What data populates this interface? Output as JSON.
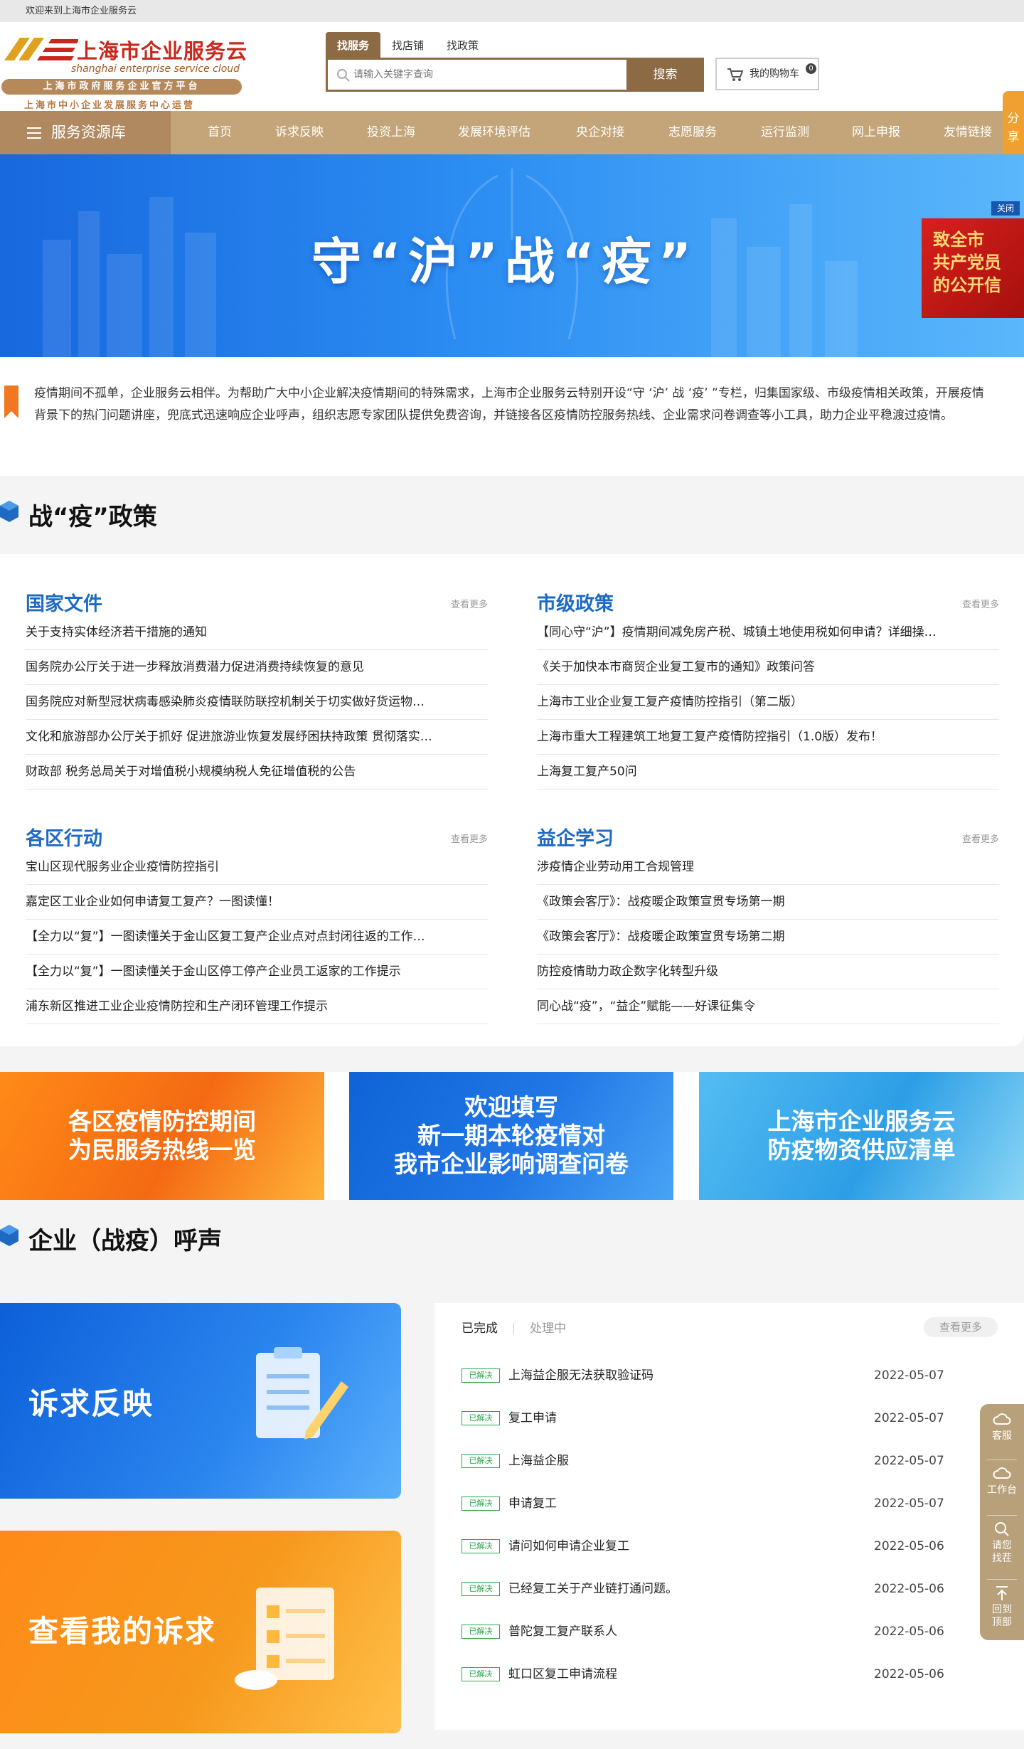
{
  "topbar": {
    "welcome": "欢迎来到上海市企业服务云"
  },
  "logo": {
    "title": "上海市企业服务云",
    "subtitle": "shanghai enterprise service cloud",
    "band": "上海市政府服务企业官方平台",
    "run": "上海市中小企业发展服务中心运营"
  },
  "search": {
    "tabs": [
      "找服务",
      "找店铺",
      "找政策"
    ],
    "placeholder": "请输入关键字查询",
    "button": "搜索"
  },
  "cart": {
    "label": "我的购物车",
    "count": "0"
  },
  "nav": {
    "resource": "服务资源库",
    "items": [
      "首页",
      "诉求反映",
      "投资上海",
      "发展环境评估",
      "央企对接",
      "志愿服务",
      "运行监测",
      "网上申报",
      "友情链接"
    ]
  },
  "share": {
    "label": "分享"
  },
  "banner": {
    "title": "守“沪”战“疫”",
    "close": "关闭",
    "promo_lines": [
      "致全市",
      "共产党员",
      "的公开信"
    ]
  },
  "intro": {
    "text": "疫情期间不孤单，企业服务云相伴。为帮助广大中小企业解决疫情期间的特殊需求，上海市企业服务云特别开设“守 ‘沪’ 战 ‘疫’ ”专栏，归集国家级、市级疫情相关政策，开展疫情背景下的热门问题讲座，兜底式迅速响应企业呼声，组织志愿专家团队提供免费咨询，并链接各区疫情防控服务热线、企业需求问卷调查等小工具，助力企业平稳渡过疫情。"
  },
  "policy": {
    "title": "战“疫”政策",
    "more": "查看更多",
    "columns": [
      {
        "title": "国家文件",
        "items": [
          "关于支持实体经济若干措施的通知",
          "国务院办公厅关于进一步释放消费潜力促进消费持续恢复的意见",
          "国务院应对新型冠状病毒感染肺炎疫情联防联控机制关于切实做好货运物…",
          "文化和旅游部办公厅关于抓好 促进旅游业恢复发展纾困扶持政策 贯彻落实…",
          "财政部 税务总局关于对增值税小规模纳税人免征增值税的公告"
        ]
      },
      {
        "title": "市级政策",
        "items": [
          "【同心守“沪”】疫情期间减免房产税、城镇土地使用税如何申请？详细操…",
          "《关于加快本市商贸企业复工复市的通知》政策问答",
          "上海市工业企业复工复产疫情防控指引（第二版）",
          "上海市重大工程建筑工地复工复产疫情防控指引（1.0版）发布！",
          "上海复工复产50问"
        ]
      },
      {
        "title": "各区行动",
        "items": [
          "宝山区现代服务业企业疫情防控指引",
          "嘉定区工业企业如何申请复工复产？一图读懂！",
          "【全力以“复”】一图读懂关于金山区复工复产企业点对点封闭往返的工作…",
          "【全力以“复”】一图读懂关于金山区停工停产企业员工返家的工作提示",
          "浦东新区推进工业企业疫情防控和生产闭环管理工作提示"
        ]
      },
      {
        "title": "益企学习",
        "items": [
          "涉疫情企业劳动用工合规管理",
          "《政策会客厅》：战疫暖企政策宣贯专场第一期",
          "《政策会客厅》：战疫暖企政策宣贯专场第二期",
          "防控疫情助力政企数字化转型升级",
          "同心战“疫”，“益企”赋能——好课征集令"
        ]
      }
    ]
  },
  "promos": [
    {
      "lines": [
        "各区疫情防控期间",
        "为民服务热线一览"
      ]
    },
    {
      "lines": [
        "欢迎填写",
        "新一期本轮疫情对",
        "我市企业影响调查问卷"
      ]
    },
    {
      "lines": [
        "上海市企业服务云",
        "防疫物资供应清单"
      ]
    }
  ],
  "voice": {
    "title": "企业（战疫）呼声",
    "card1": "诉求反映",
    "card2": "查看我的诉求",
    "tabs": [
      "已完成",
      "处理中"
    ],
    "more": "查看更多",
    "badge": "已解决",
    "requests": [
      {
        "text": "上海益企服无法获取验证码",
        "date": "2022-05-07"
      },
      {
        "text": "复工申请",
        "date": "2022-05-07"
      },
      {
        "text": "上海益企服",
        "date": "2022-05-07"
      },
      {
        "text": "申请复工",
        "date": "2022-05-07"
      },
      {
        "text": "请问如何申请企业复工",
        "date": "2022-05-06"
      },
      {
        "text": "已经复工关于产业链打通问题。",
        "date": "2022-05-06"
      },
      {
        "text": "普陀复工复产联系人",
        "date": "2022-05-06"
      },
      {
        "text": "虹口区复工申请流程",
        "date": "2022-05-06"
      }
    ]
  },
  "floatbar": {
    "service": "客服",
    "workbench": "工作台",
    "find": [
      "请您",
      "找茬"
    ],
    "top": [
      "回到",
      "顶部"
    ]
  },
  "colors": {
    "brand": "#8b6a44",
    "nav": "#c4a579",
    "title_blue": "#1e6ac3",
    "resolved": "#28a745"
  }
}
